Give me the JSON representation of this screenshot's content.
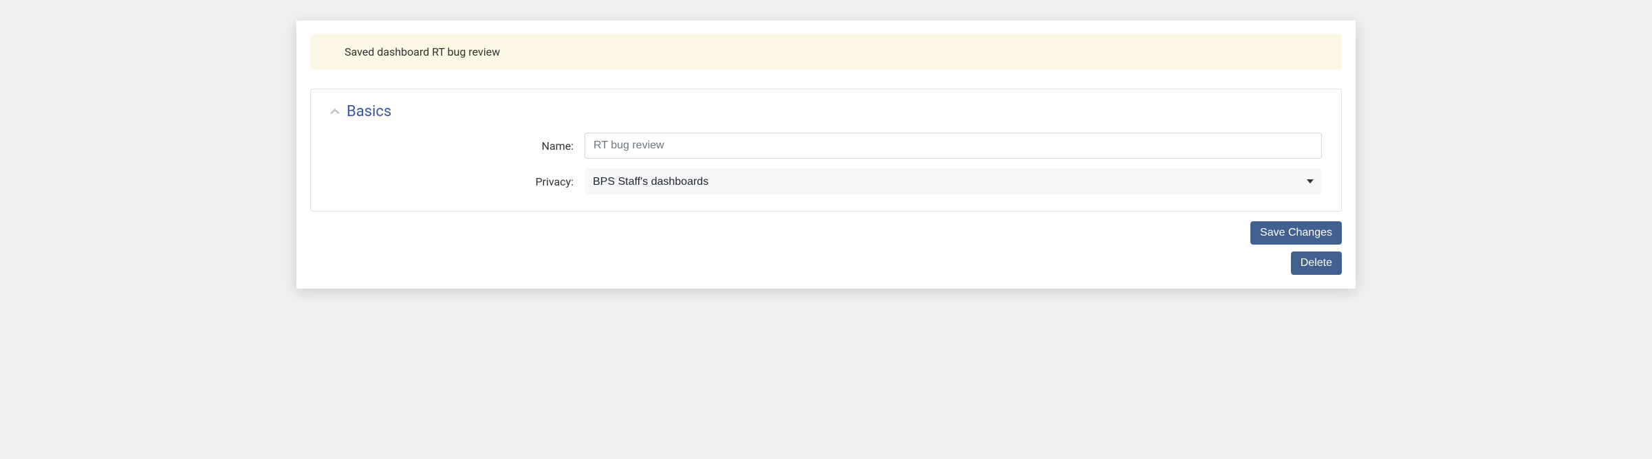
{
  "alert": {
    "message": "Saved dashboard RT bug review"
  },
  "panel": {
    "title": "Basics",
    "name": {
      "label": "Name:",
      "value": "RT bug review"
    },
    "privacy": {
      "label": "Privacy:",
      "value": "BPS Staff's dashboards"
    }
  },
  "actions": {
    "save": "Save Changes",
    "delete": "Delete"
  }
}
